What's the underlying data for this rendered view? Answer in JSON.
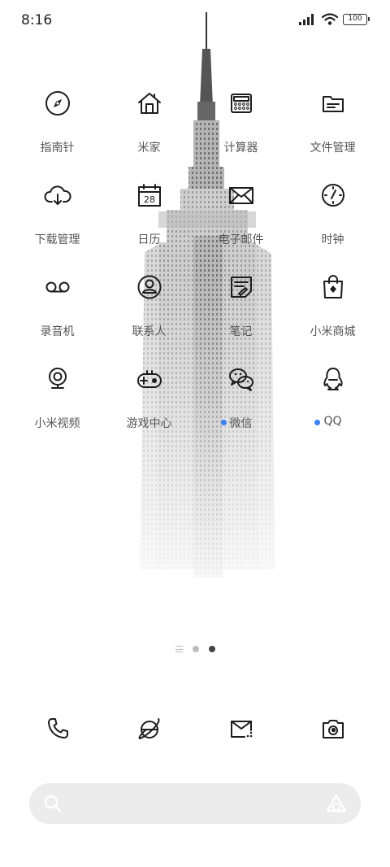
{
  "status_bar": {
    "time": "8:16",
    "battery": "100",
    "icons": [
      "signal-icon",
      "wifi-icon",
      "battery-icon"
    ]
  },
  "apps": [
    {
      "label": "指南针",
      "icon": "compass-icon"
    },
    {
      "label": "米家",
      "icon": "home-icon"
    },
    {
      "label": "计算器",
      "icon": "calculator-icon"
    },
    {
      "label": "文件管理",
      "icon": "folder-icon"
    },
    {
      "label": "下载管理",
      "icon": "cloud-download-icon"
    },
    {
      "label": "日历",
      "icon": "calendar-icon",
      "icon_text": "28"
    },
    {
      "label": "电子邮件",
      "icon": "mail-icon"
    },
    {
      "label": "时钟",
      "icon": "clock-icon"
    },
    {
      "label": "录音机",
      "icon": "recorder-icon"
    },
    {
      "label": "联系人",
      "icon": "contacts-icon"
    },
    {
      "label": "笔记",
      "icon": "notes-icon"
    },
    {
      "label": "小米商城",
      "icon": "shopping-bag-icon"
    },
    {
      "label": "小米视频",
      "icon": "video-camera-icon"
    },
    {
      "label": "游戏中心",
      "icon": "gamepad-icon"
    },
    {
      "label": "微信",
      "icon": "wechat-icon",
      "badge": true
    },
    {
      "label": "QQ",
      "icon": "qq-penguin-icon",
      "badge": true
    }
  ],
  "pager": {
    "pages": 2,
    "current": 2
  },
  "dock": [
    {
      "icon": "phone-icon"
    },
    {
      "icon": "browser-icon"
    },
    {
      "icon": "messages-icon"
    },
    {
      "icon": "camera-icon"
    }
  ],
  "search": {
    "placeholder": "",
    "value": ""
  },
  "colors": {
    "badge": "#3b82f6",
    "search_bg": "#ececec",
    "icon_stroke": "#1d1d1d"
  }
}
